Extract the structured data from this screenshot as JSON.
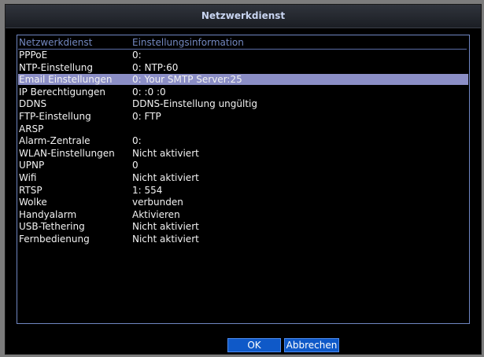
{
  "dialog": {
    "title": "Netzwerkdienst"
  },
  "table": {
    "columns": [
      "Netzwerkdienst",
      "Einstellungsinformation"
    ],
    "selected_index": 2,
    "rows": [
      {
        "service": "PPPoE",
        "info": "0:"
      },
      {
        "service": "NTP-Einstellung",
        "info": "0: NTP:60"
      },
      {
        "service": "Email Einstellungen",
        "info": "0: Your SMTP Server:25"
      },
      {
        "service": "IP Berechtigungen",
        "info": "0: :0 :0"
      },
      {
        "service": "DDNS",
        "info": "DDNS-Einstellung ungültig"
      },
      {
        "service": "FTP-Einstellung",
        "info": "0: FTP"
      },
      {
        "service": "ARSP",
        "info": ""
      },
      {
        "service": "Alarm-Zentrale",
        "info": "0:"
      },
      {
        "service": "WLAN-Einstellungen",
        "info": "Nicht aktiviert"
      },
      {
        "service": "UPNP",
        "info": "0"
      },
      {
        "service": "Wifi",
        "info": "Nicht aktiviert"
      },
      {
        "service": "RTSP",
        "info": "1: 554"
      },
      {
        "service": "Wolke",
        "info": "verbunden"
      },
      {
        "service": "Handyalarm",
        "info": "Aktivieren"
      },
      {
        "service": "USB-Tethering",
        "info": "Nicht aktiviert"
      },
      {
        "service": "Fernbedienung",
        "info": "Nicht aktiviert"
      }
    ]
  },
  "buttons": {
    "ok": "OK",
    "cancel": "Abbrechen"
  },
  "colors": {
    "background": "#7c7c7c",
    "selection": "#8b8ec6",
    "header_text": "#7388c0",
    "button": "#0f59c8"
  }
}
